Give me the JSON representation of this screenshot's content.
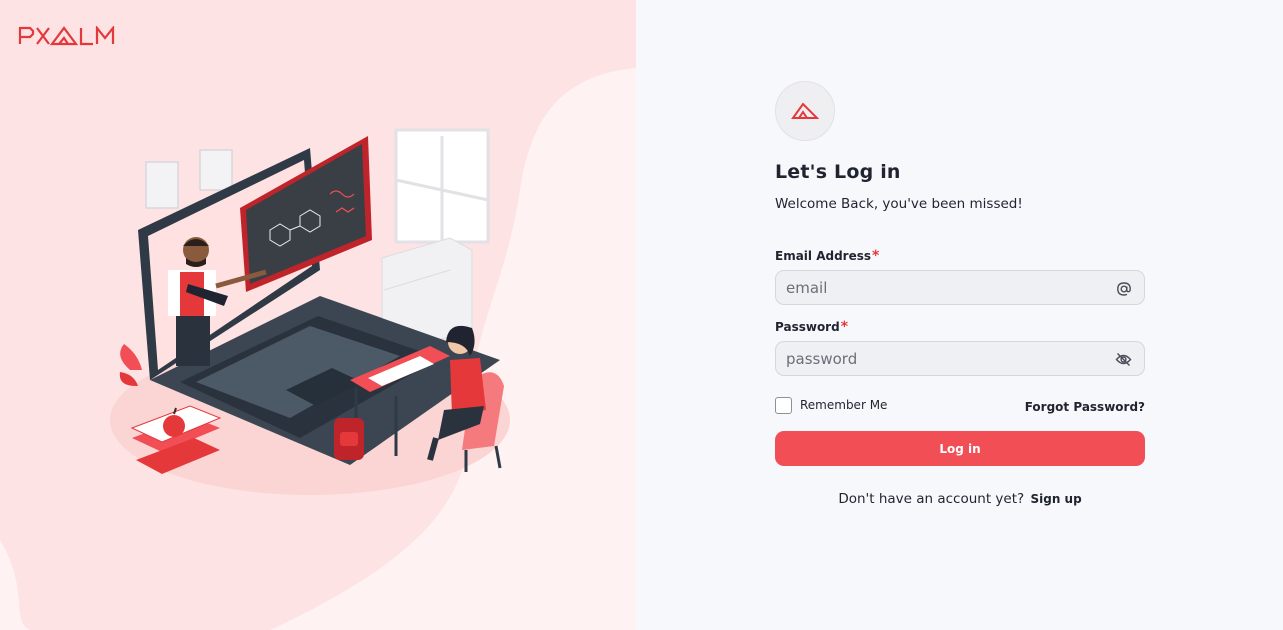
{
  "brand": {
    "logo_text": "PXALM",
    "accent": "#e5383b"
  },
  "colors": {
    "left_bg": "#fde6e6",
    "button": "#f24e55"
  },
  "form": {
    "title": "Let's Log in",
    "subtitle": "Welcome Back, you've been missed!",
    "email": {
      "label": "Email Address",
      "required_mark": "*",
      "placeholder": "email",
      "value": "",
      "icon": "at-icon"
    },
    "password": {
      "label": "Password",
      "required_mark": "*",
      "placeholder": "password",
      "value": "",
      "icon": "eye-off-icon"
    },
    "remember_me": {
      "label": "Remember Me",
      "checked": false
    },
    "forgot_password": "Forgot Password?",
    "login_button": "Log in",
    "signup_prompt": "Don't have an account yet?",
    "signup_link": "Sign up"
  },
  "illustration": {
    "icon": "online-class-illustration"
  }
}
